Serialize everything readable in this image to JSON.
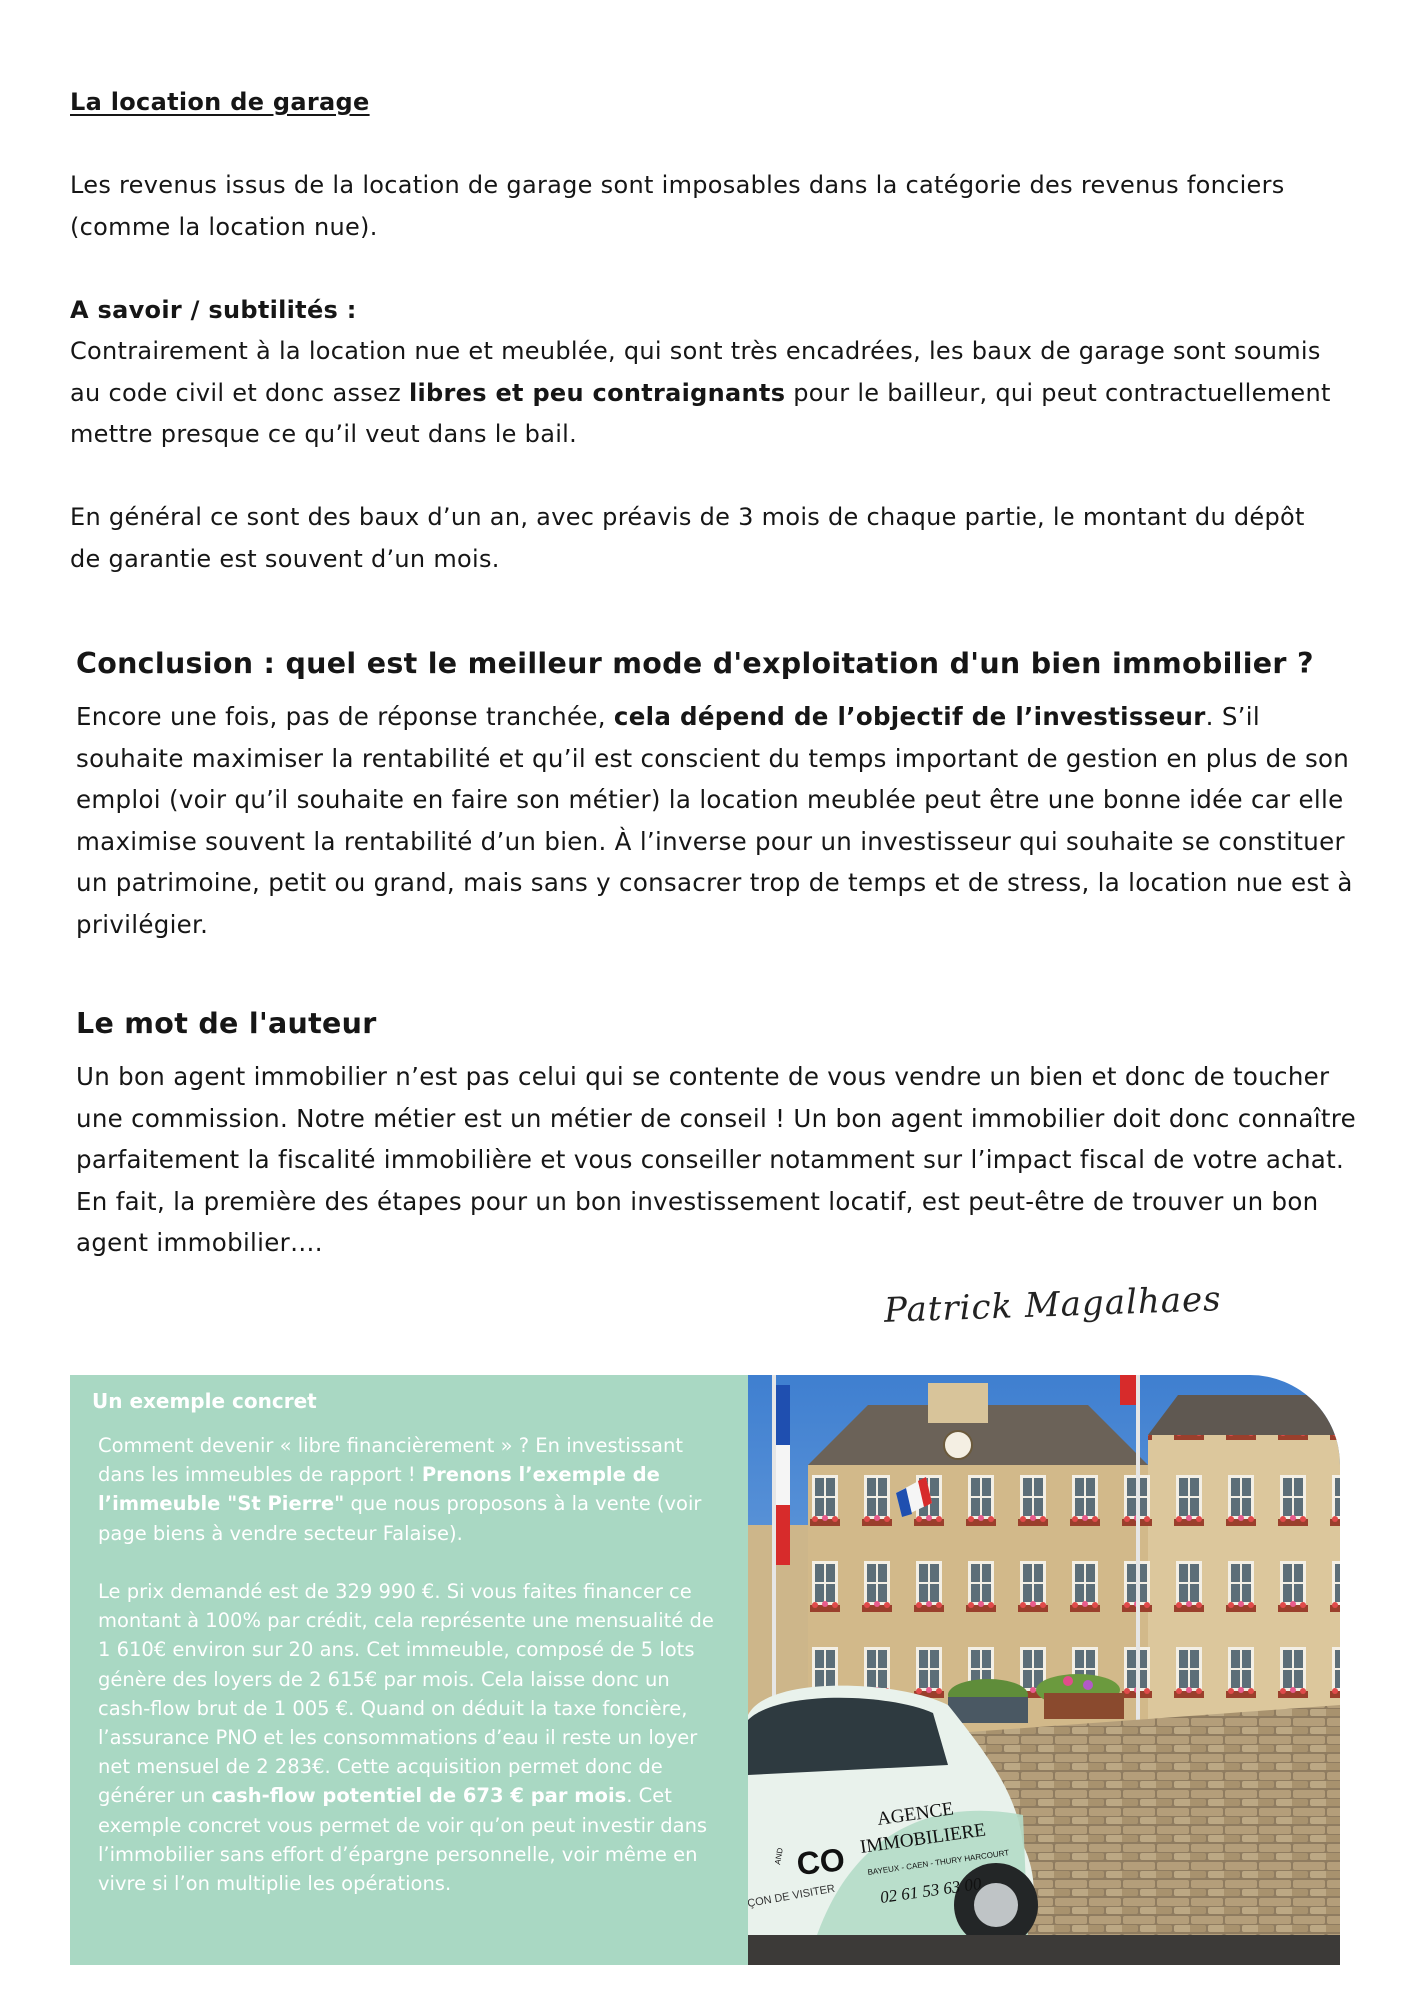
{
  "garage": {
    "title": "La location de garage",
    "p1": "Les revenus issus de la location de garage sont imposables dans la catégorie des revenus fonciers (comme la location nue).",
    "subtitle": "A savoir / subtilités :",
    "p2_before": "Contrairement à la location nue et meublée, qui sont très encadrées, les baux de garage sont soumis au code civil et donc assez ",
    "p2_bold": "libres et peu contraignants",
    "p2_after": " pour le bailleur, qui peut contractuellement mettre presque ce qu’il veut dans le bail.",
    "p3": "En général ce sont des baux d’un an, avec préavis de 3 mois de chaque partie, le montant du dépôt de garantie est souvent d’un mois."
  },
  "conclusion": {
    "title": "Conclusion : quel est le meilleur mode d'exploitation d'un bien immobilier ?",
    "before": "Encore une fois, pas de réponse tranchée, ",
    "bold": "cela dépend de l’objectif de l’investisseur",
    "after": ". S’il souhaite maximiser la rentabilité et qu’il est conscient du temps important de gestion en plus de son emploi (voir qu’il souhaite en faire son métier) la location meublée peut être une bonne idée car elle maximise souvent la rentabilité d’un bien. À l’inverse pour un investisseur qui souhaite se constituer un patrimoine, petit ou grand, mais sans y consacrer trop de temps et de stress, la location nue est à privilégier."
  },
  "author": {
    "title": "Le mot de l'auteur",
    "p1": "Un bon agent immobilier n’est pas celui qui se contente de vous vendre un bien et donc de toucher une commission. Notre métier est un métier de conseil ! Un bon agent immobilier doit donc connaître parfaitement la fiscalité immobilière et vous conseiller notamment sur l’impact fiscal de votre achat.",
    "p2": "En fait, la première des étapes pour un bon investissement locatif, est peut-être de trouver un bon agent immobilier….",
    "signature": "Patrick Magalhaes"
  },
  "example": {
    "title": "Un exemple concret",
    "p1_before": "Comment devenir « libre financièrement » ? En investissant dans les immeubles de rapport ! ",
    "p1_bold": "Prenons l’exemple de l’immeuble \"St Pierre\"",
    "p1_after": " que nous proposons à la vente (voir page biens à vendre secteur Falaise).",
    "p2_before": "Le prix demandé est de 329 990 €. Si vous faites financer ce montant à 100% par crédit, cela représente une mensualité de 1 610€ environ sur 20 ans. Cet immeuble, composé de 5 lots génère des loyers de 2 615€ par mois. Cela laisse donc un cash-flow brut de 1 005 €. Quand on déduit la taxe foncière, l’assurance PNO et les consommations d’eau il reste un loyer net mensuel de 2 283€. Cette acquisition permet donc de générer un ",
    "p2_bold": "cash-flow potentiel de 673 € par mois",
    "p2_after": ". Cet exemple concret vous permet de voir qu’on peut investir dans l’immobilier sans effort d’épargne personnelle, voir même en vivre si l’on multiplie les opérations."
  },
  "photo": {
    "car_line1": "AGENCE",
    "car_line2": "IMMOBILIERE",
    "car_line3": "BAYEUX - CAEN - THURY HARCOURT",
    "car_phone": "02 61 53 63 00",
    "car_logo": "CO",
    "car_logo_small": "AND",
    "car_slogan": "ÇON DE VISITER"
  },
  "colors": {
    "box_background": "#a9d8c3",
    "stone": "#d2b98a",
    "car_body": "#e9f2ec"
  }
}
